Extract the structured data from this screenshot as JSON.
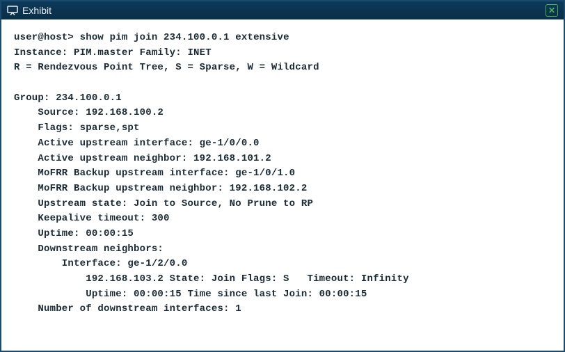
{
  "window": {
    "title": "Exhibit"
  },
  "term": {
    "cmd_prompt": "user@host> ",
    "cmd_text": "show pim join 234.100.0.1 extensive",
    "instance_line": "Instance: PIM.master Family: INET",
    "legend_line": "R = Rendezvous Point Tree, S = Sparse, W = Wildcard",
    "group_line": "Group: 234.100.0.1",
    "source_line": "    Source: 192.168.100.2",
    "flags_line": "    Flags: sparse,spt",
    "active_if_line": "    Active upstream interface: ge-1/0/0.0",
    "active_nbr_line": "    Active upstream neighbor: 192.168.101.2",
    "mofrr_if_line": "    MoFRR Backup upstream interface: ge-1/0/1.0",
    "mofrr_nbr_line": "    MoFRR Backup upstream neighbor: 192.168.102.2",
    "upstate_line": "    Upstream state: Join to Source, No Prune to RP",
    "keepalive_line": "    Keepalive timeout: 300",
    "uptime_line": "    Uptime: 00:00:15",
    "ds_hdr_line": "    Downstream neighbors:",
    "ds_if_line": "        Interface: ge-1/2/0.0",
    "ds_detail1": "            192.168.103.2 State: Join Flags: S   Timeout: Infinity",
    "ds_detail2": "            Uptime: 00:00:15 Time since last Join: 00:00:15",
    "ds_count_line": "    Number of downstream interfaces: 1"
  }
}
